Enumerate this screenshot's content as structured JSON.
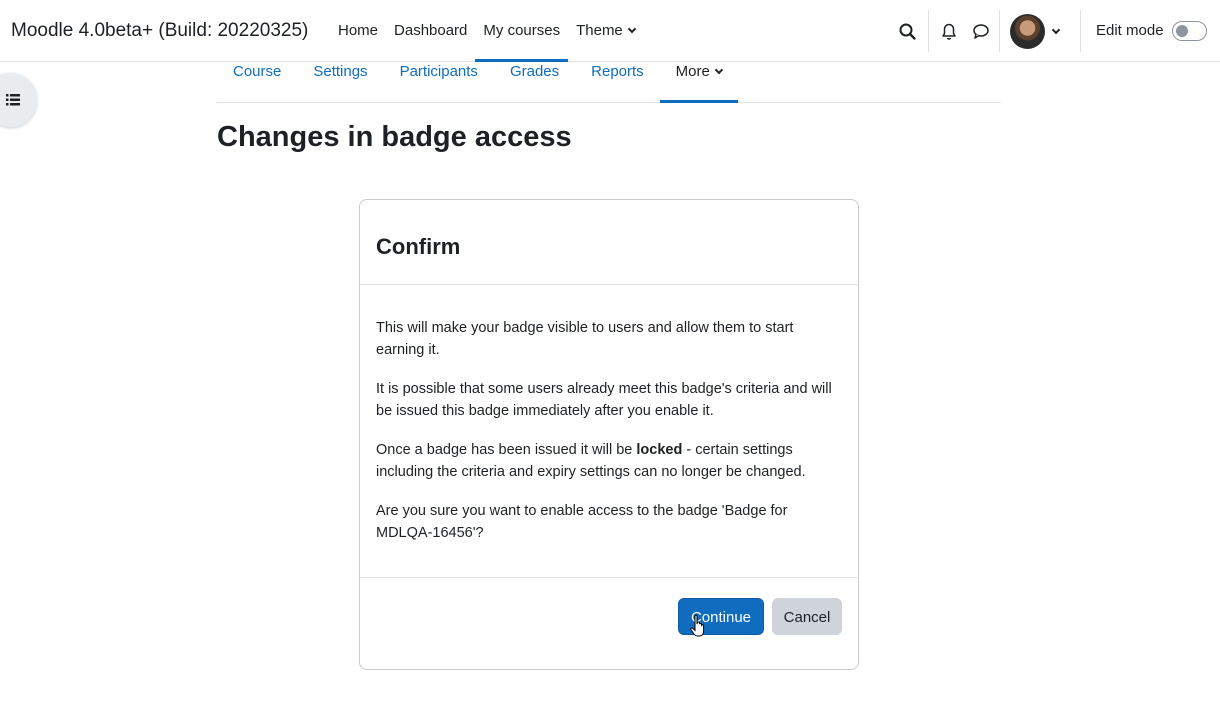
{
  "header": {
    "site_name": "Moodle 4.0beta+ (Build: 20220325)",
    "nav": [
      {
        "label": "Home"
      },
      {
        "label": "Dashboard"
      },
      {
        "label": "My courses"
      },
      {
        "label": "Theme"
      }
    ],
    "edit_mode_label": "Edit mode",
    "edit_mode_on": false,
    "icons": [
      "search-icon",
      "bell-icon",
      "chat-icon",
      "user-avatar",
      "chevron-down-icon"
    ]
  },
  "drawer": {
    "icon": "list-icon"
  },
  "secondary_nav": {
    "items": [
      {
        "label": "Course"
      },
      {
        "label": "Settings"
      },
      {
        "label": "Participants"
      },
      {
        "label": "Grades"
      },
      {
        "label": "Reports"
      },
      {
        "label": "More"
      }
    ]
  },
  "page": {
    "title": "Changes in badge access"
  },
  "dialog": {
    "title": "Confirm",
    "p1": "This will make your badge visible to users and allow them to start earning it.",
    "p2": "It is possible that some users already meet this badge's criteria and will be issued this badge immediately after you enable it.",
    "p3_before": "Once a badge has been issued it will be ",
    "p3_bold": "locked",
    "p3_after": " - certain settings including the criteria and expiry settings can no longer be changed.",
    "p4": "Are you sure you want to enable access to the badge 'Badge for MDLQA-16456'?",
    "continue_label": "Continue",
    "cancel_label": "Cancel"
  },
  "colors": {
    "accent": "#0f6cbf",
    "text": "#1d2125",
    "secondary_button": "#ced4da"
  }
}
